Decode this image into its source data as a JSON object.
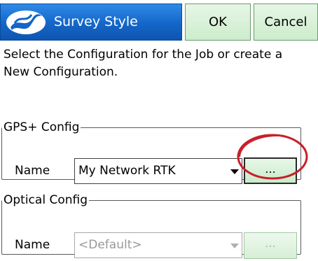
{
  "titlebar": {
    "title": "Survey Style",
    "ok_label": "OK",
    "cancel_label": "Cancel",
    "logo_icon": "app-logo-icon",
    "accent_color": "#1466c8"
  },
  "instructions": "Select the Configuration for the Job or create a New Configuration.",
  "gps_config": {
    "legend": "GPS+ Config",
    "name_label": "Name",
    "selected": "My Network RTK",
    "browse_label": "..."
  },
  "optical_config": {
    "legend": "Optical Config",
    "name_label": "Name",
    "selected": "<Default>",
    "browse_label": "..."
  },
  "annotation": {
    "highlight_color": "#c8202a"
  }
}
